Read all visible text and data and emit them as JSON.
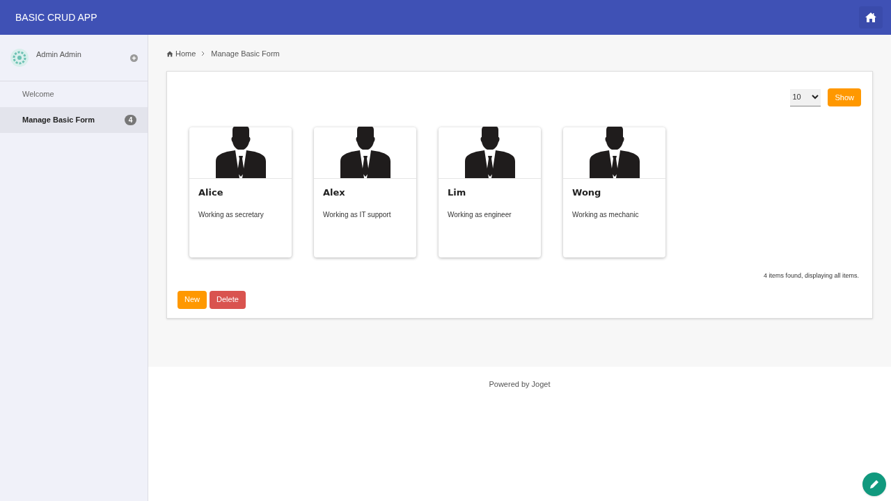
{
  "header": {
    "title": "BASIC CRUD APP"
  },
  "sidebar": {
    "user": "Admin Admin",
    "items": [
      {
        "label": "Welcome",
        "selected": false
      },
      {
        "label": "Manage Basic Form",
        "selected": true,
        "badge": "4"
      }
    ]
  },
  "breadcrumb": [
    "Home",
    "Manage Basic Form"
  ],
  "page_size": {
    "value": "10"
  },
  "show_button": "Show",
  "cards": [
    {
      "name": "Alice",
      "description": "Working as secretary"
    },
    {
      "name": "Alex",
      "description": "Working as IT support"
    },
    {
      "name": "Lim",
      "description": "Working as engineer"
    },
    {
      "name": "Wong",
      "description": "Working as mechanic"
    }
  ],
  "summary": "4 items found, displaying all items.",
  "buttons": [
    {
      "label": "New",
      "kind": "primary"
    },
    {
      "label": "Delete",
      "kind": "danger"
    }
  ],
  "footer": "Powered by Joget"
}
